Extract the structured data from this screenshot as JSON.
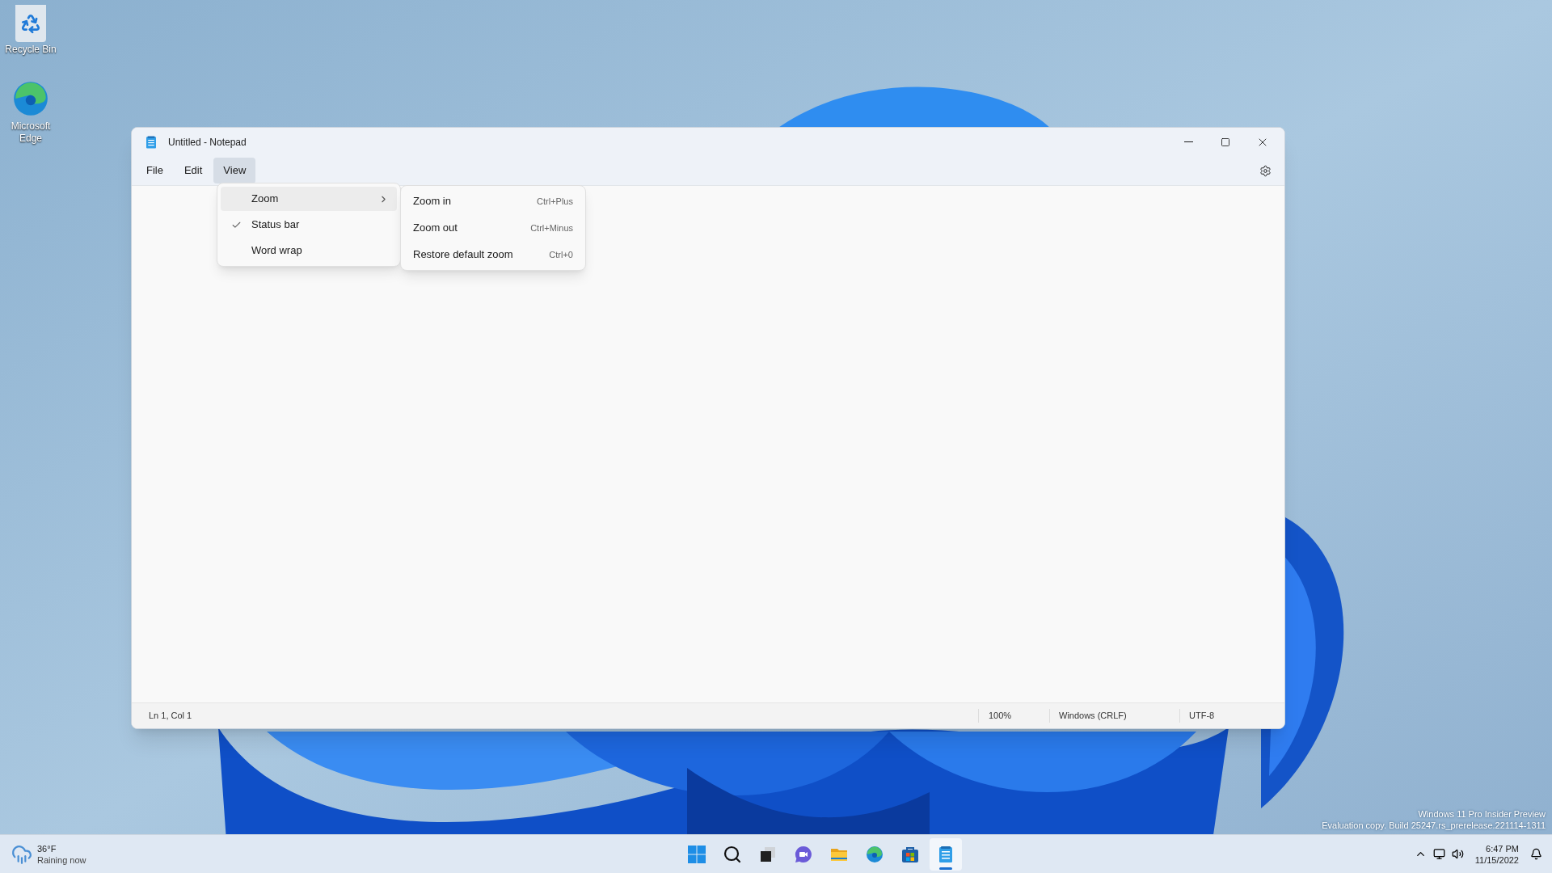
{
  "desktop_icons": [
    {
      "kind": "recycle-bin",
      "label": "Recycle Bin"
    },
    {
      "kind": "edge",
      "label": "Microsoft Edge"
    }
  ],
  "window": {
    "title": "Untitled - Notepad"
  },
  "menu_bar": [
    {
      "label": "File",
      "selected": false
    },
    {
      "label": "Edit",
      "selected": false
    },
    {
      "label": "View",
      "selected": true
    }
  ],
  "view_menu": [
    {
      "label": "Zoom",
      "checked": false,
      "selected": true,
      "has_submenu": true
    },
    {
      "label": "Status bar",
      "checked": true,
      "selected": false,
      "has_submenu": false
    },
    {
      "label": "Word wrap",
      "checked": false,
      "selected": false,
      "has_submenu": false
    }
  ],
  "zoom_submenu": [
    {
      "label": "Zoom in",
      "shortcut": "Ctrl+Plus"
    },
    {
      "label": "Zoom out",
      "shortcut": "Ctrl+Minus"
    },
    {
      "label": "Restore default zoom",
      "shortcut": "Ctrl+0"
    }
  ],
  "status_bar": {
    "position": "Ln 1, Col 1",
    "zoom": "100%",
    "line_ending": "Windows (CRLF)",
    "encoding": "UTF-8"
  },
  "desktop_notice": [
    "Windows 11 Pro Insider Preview",
    "Evaluation copy. Build 25247.rs_prerelease.221114-1311"
  ],
  "taskbar": {
    "weather": {
      "temperature": "36°F",
      "condition": "Raining now"
    },
    "apps": [
      {
        "kind": "start",
        "selected": false
      },
      {
        "kind": "search",
        "selected": false
      },
      {
        "kind": "task-view",
        "selected": false
      },
      {
        "kind": "chat",
        "selected": false
      },
      {
        "kind": "explorer",
        "selected": false
      },
      {
        "kind": "edge",
        "selected": false
      },
      {
        "kind": "store",
        "selected": false
      },
      {
        "kind": "notepad",
        "selected": true
      }
    ],
    "time": "6:47 PM",
    "date": "11/15/2022"
  }
}
